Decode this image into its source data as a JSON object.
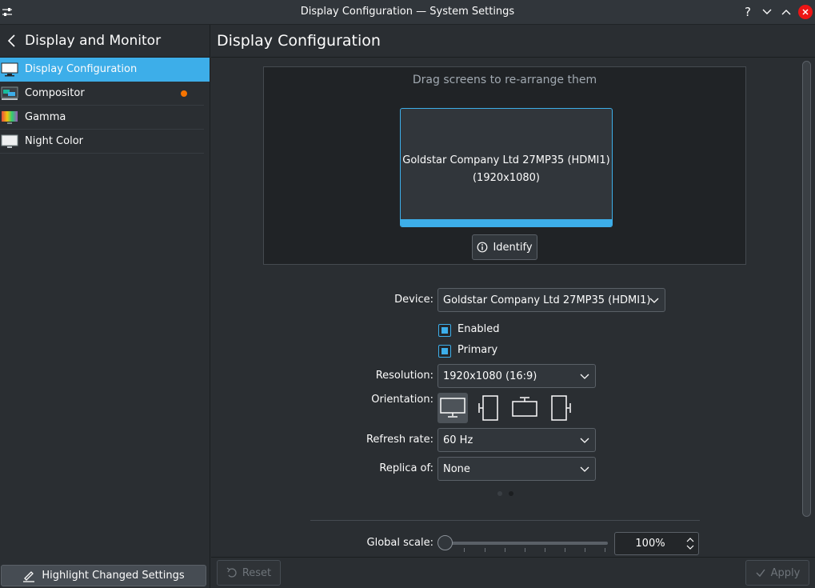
{
  "window": {
    "title": "Display Configuration — System Settings",
    "help_glyph": "?"
  },
  "sidebar": {
    "heading": "Display and Monitor",
    "items": [
      {
        "label": "Display Configuration",
        "active": true
      },
      {
        "label": "Compositor",
        "modified": true
      },
      {
        "label": "Gamma"
      },
      {
        "label": "Night Color"
      }
    ],
    "highlight_button": "Highlight Changed Settings"
  },
  "main": {
    "heading": "Display Configuration",
    "arrange_hint": "Drag screens to re-arrange them",
    "screen": {
      "name": "Goldstar Company Ltd 27MP35 (HDMI1)",
      "resolution": "(1920x1080)"
    },
    "identify_label": "Identify",
    "form": {
      "device_label": "Device:",
      "device_value": "Goldstar Company Ltd 27MP35 (HDMI1)",
      "enabled_label": "Enabled",
      "primary_label": "Primary",
      "resolution_label": "Resolution:",
      "resolution_value": "1920x1080 (16:9)",
      "orientation_label": "Orientation:",
      "refresh_label": "Refresh rate:",
      "refresh_value": "60 Hz",
      "replica_label": "Replica of:",
      "replica_value": "None",
      "scale_label": "Global scale:",
      "scale_value": "100%",
      "scale_fraction": 0
    }
  },
  "footer": {
    "reset_label": "Reset",
    "apply_label": "Apply"
  },
  "colors": {
    "accent": "#3daee9",
    "modified_dot": "#f67400",
    "close": "#ed1515"
  }
}
